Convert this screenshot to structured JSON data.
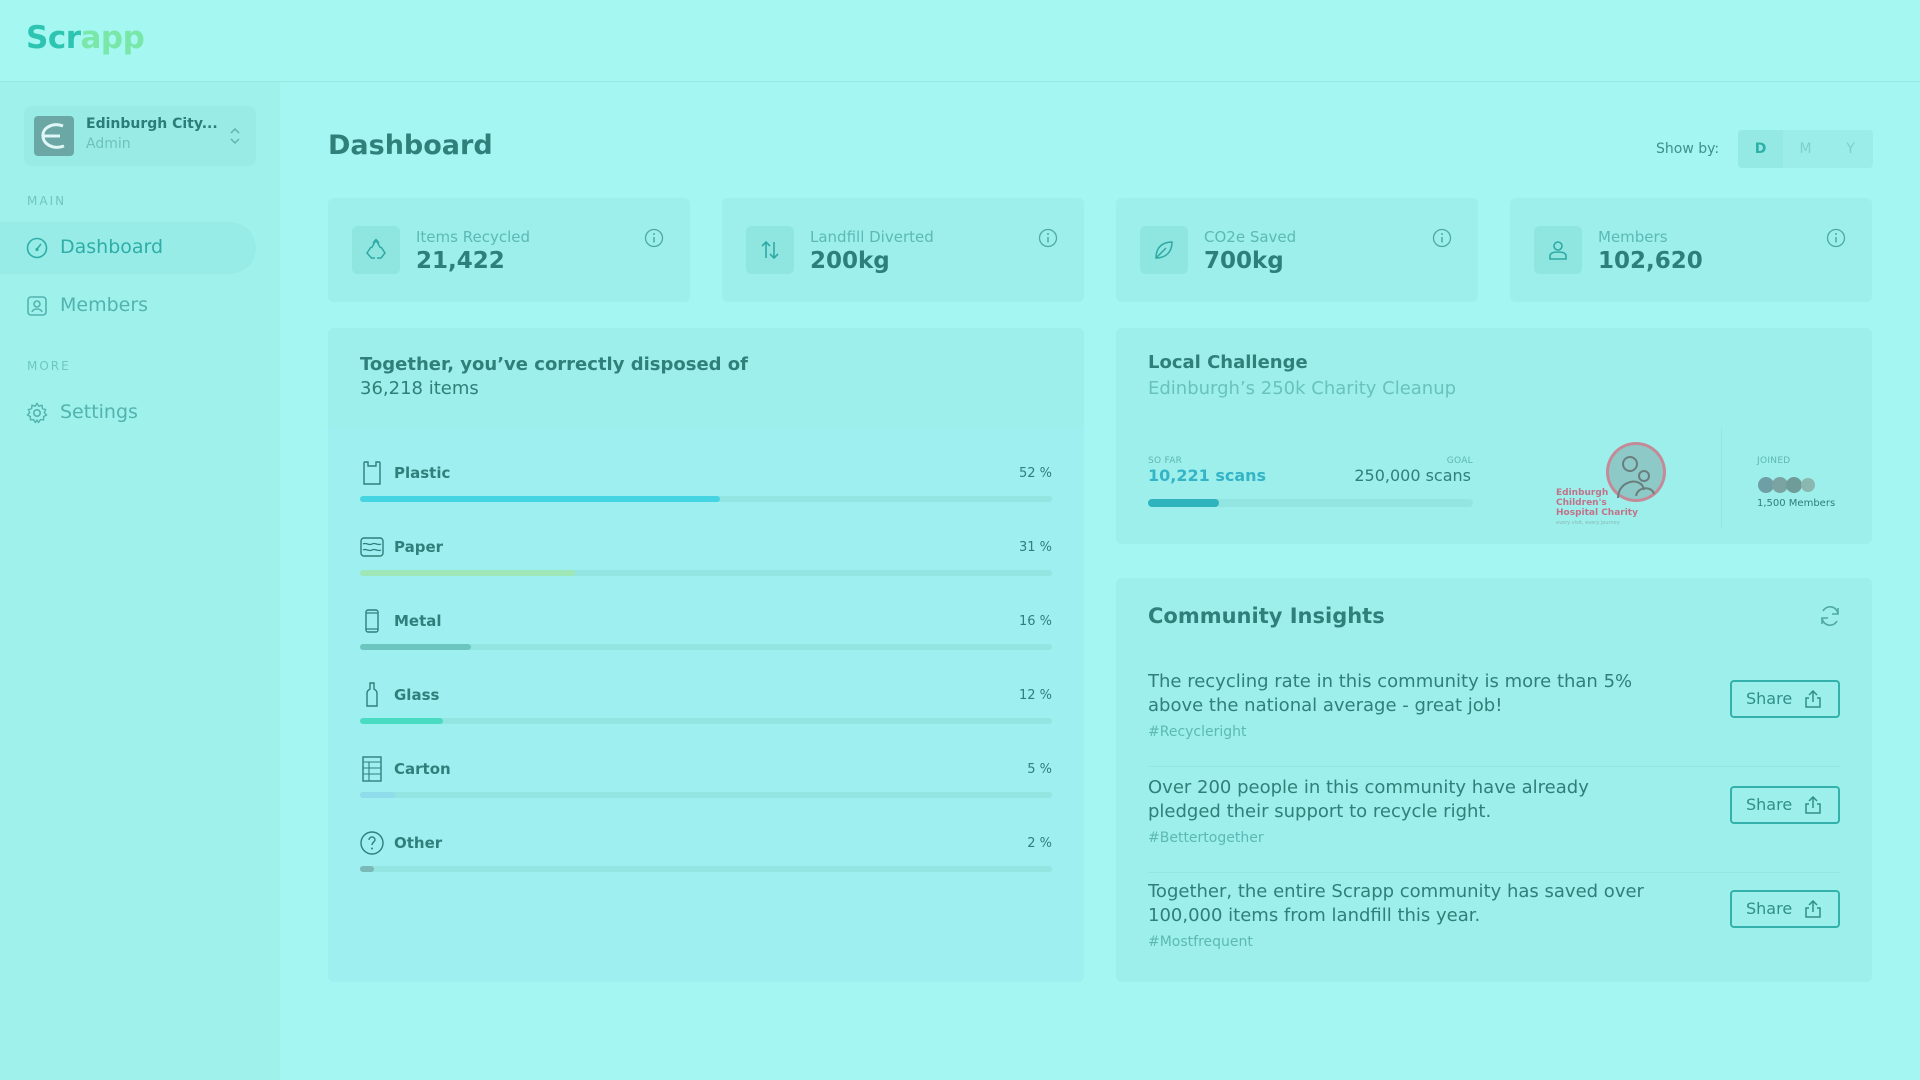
{
  "app": {
    "logo_part1": "Scr",
    "logo_part2": "app"
  },
  "sidebar": {
    "org_name": "Edinburgh City...",
    "org_role": "Admin",
    "section_main": "MAIN",
    "section_more": "MORE",
    "items": [
      {
        "label": "Dashboard",
        "icon": "gauge-icon",
        "active": true
      },
      {
        "label": "Members",
        "icon": "members-icon",
        "active": false
      },
      {
        "label": "Settings",
        "icon": "gear-icon",
        "active": false
      }
    ]
  },
  "header": {
    "title": "Dashboard",
    "show_by_label": "Show by:",
    "show_by_options": [
      "D",
      "M",
      "Y"
    ],
    "show_by_selected": "D"
  },
  "stats": [
    {
      "label": "Items Recycled",
      "value": "21,422",
      "icon": "recycle-icon"
    },
    {
      "label": "Landfill Diverted",
      "value": "200kg",
      "icon": "arrows-up-down-icon"
    },
    {
      "label": "CO2e Saved",
      "value": "700kg",
      "icon": "leaf-icon"
    },
    {
      "label": "Members",
      "value": "102,620",
      "icon": "person-icon"
    }
  ],
  "disposed": {
    "title": "Together, you’ve correctly disposed of",
    "count": "36,218 items",
    "materials": [
      {
        "label": "Plastic",
        "pct_text": "52 %",
        "pct": 52,
        "color": "#44d4e2",
        "icon": "plastic-bag-icon"
      },
      {
        "label": "Paper",
        "pct_text": "31 %",
        "pct": 31,
        "color": "#9fe7b6",
        "icon": "paper-icon"
      },
      {
        "label": "Metal",
        "pct_text": "16 %",
        "pct": 16,
        "color": "#6cc6bf",
        "icon": "can-icon"
      },
      {
        "label": "Glass",
        "pct_text": "12 %",
        "pct": 12,
        "color": "#49dcc3",
        "icon": "bottle-icon"
      },
      {
        "label": "Carton",
        "pct_text": "5 %",
        "pct": 5,
        "color": "#8fdcea",
        "icon": "carton-icon"
      },
      {
        "label": "Other",
        "pct_text": "2 %",
        "pct": 2,
        "color": "#7ab9b7",
        "icon": "question-icon"
      }
    ]
  },
  "challenge": {
    "title": "Local Challenge",
    "subtitle": "Edinburgh’s 250k Charity Cleanup",
    "so_far_label": "SO FAR",
    "so_far_value": "10,221 scans",
    "goal_label": "GOAL",
    "goal_value": "250,000 scans",
    "progress": 0.2182,
    "charity_line1": "Edinburgh",
    "charity_line2": "Children's",
    "charity_line3": "Hospital Charity",
    "charity_tagline": "every visit, every journey",
    "joined_label": "JOINED",
    "joined_count": "1,500 Members"
  },
  "insights": {
    "title": "Community Insights",
    "share_label": "Share",
    "items": [
      {
        "text": "The recycling rate in this community is more than 5% above the national average - great job!",
        "tag": "#Recycleright"
      },
      {
        "text": "Over 200 people in this community have already pledged their support to recycle right.",
        "tag": "#Bettertogether"
      },
      {
        "text": "Together, the entire Scrapp community has saved over 100,000 items from landfill this year.",
        "tag": "#Mostfrequent"
      }
    ]
  }
}
